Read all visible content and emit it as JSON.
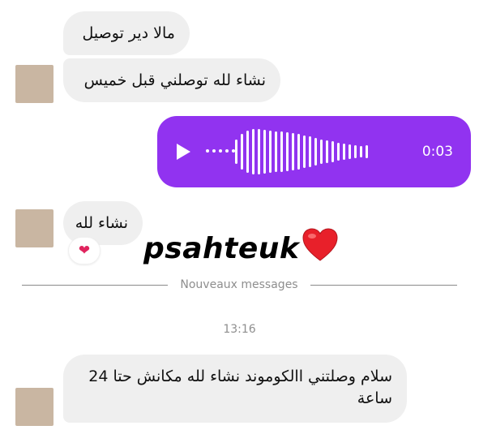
{
  "conversation": {
    "messages_top": [
      {
        "text": "مالا دير توصيل"
      },
      {
        "text": "نشاء لله توصلني قبل خميس"
      }
    ],
    "voice_message": {
      "duration": "0:03",
      "accent_color": "#9133f0",
      "icon": "play-icon"
    },
    "message_short": {
      "text": "نشاء لله"
    },
    "reaction": {
      "emoji": "❤",
      "icon": "heart-icon"
    },
    "divider": {
      "label": "Nouveaux messages"
    },
    "timestamp": "13:16",
    "last_message": {
      "text": "سلام وصلتني االكوموند نشاء لله مكانش حتا 24 ساعة"
    }
  },
  "watermark": {
    "text": "psahteuk",
    "icon": "heart-icon",
    "color": "#e8202a"
  },
  "colors": {
    "incoming_bubble": "#efefef",
    "meta_text": "#8e8e8e",
    "avatar": "#c9b6a2"
  }
}
